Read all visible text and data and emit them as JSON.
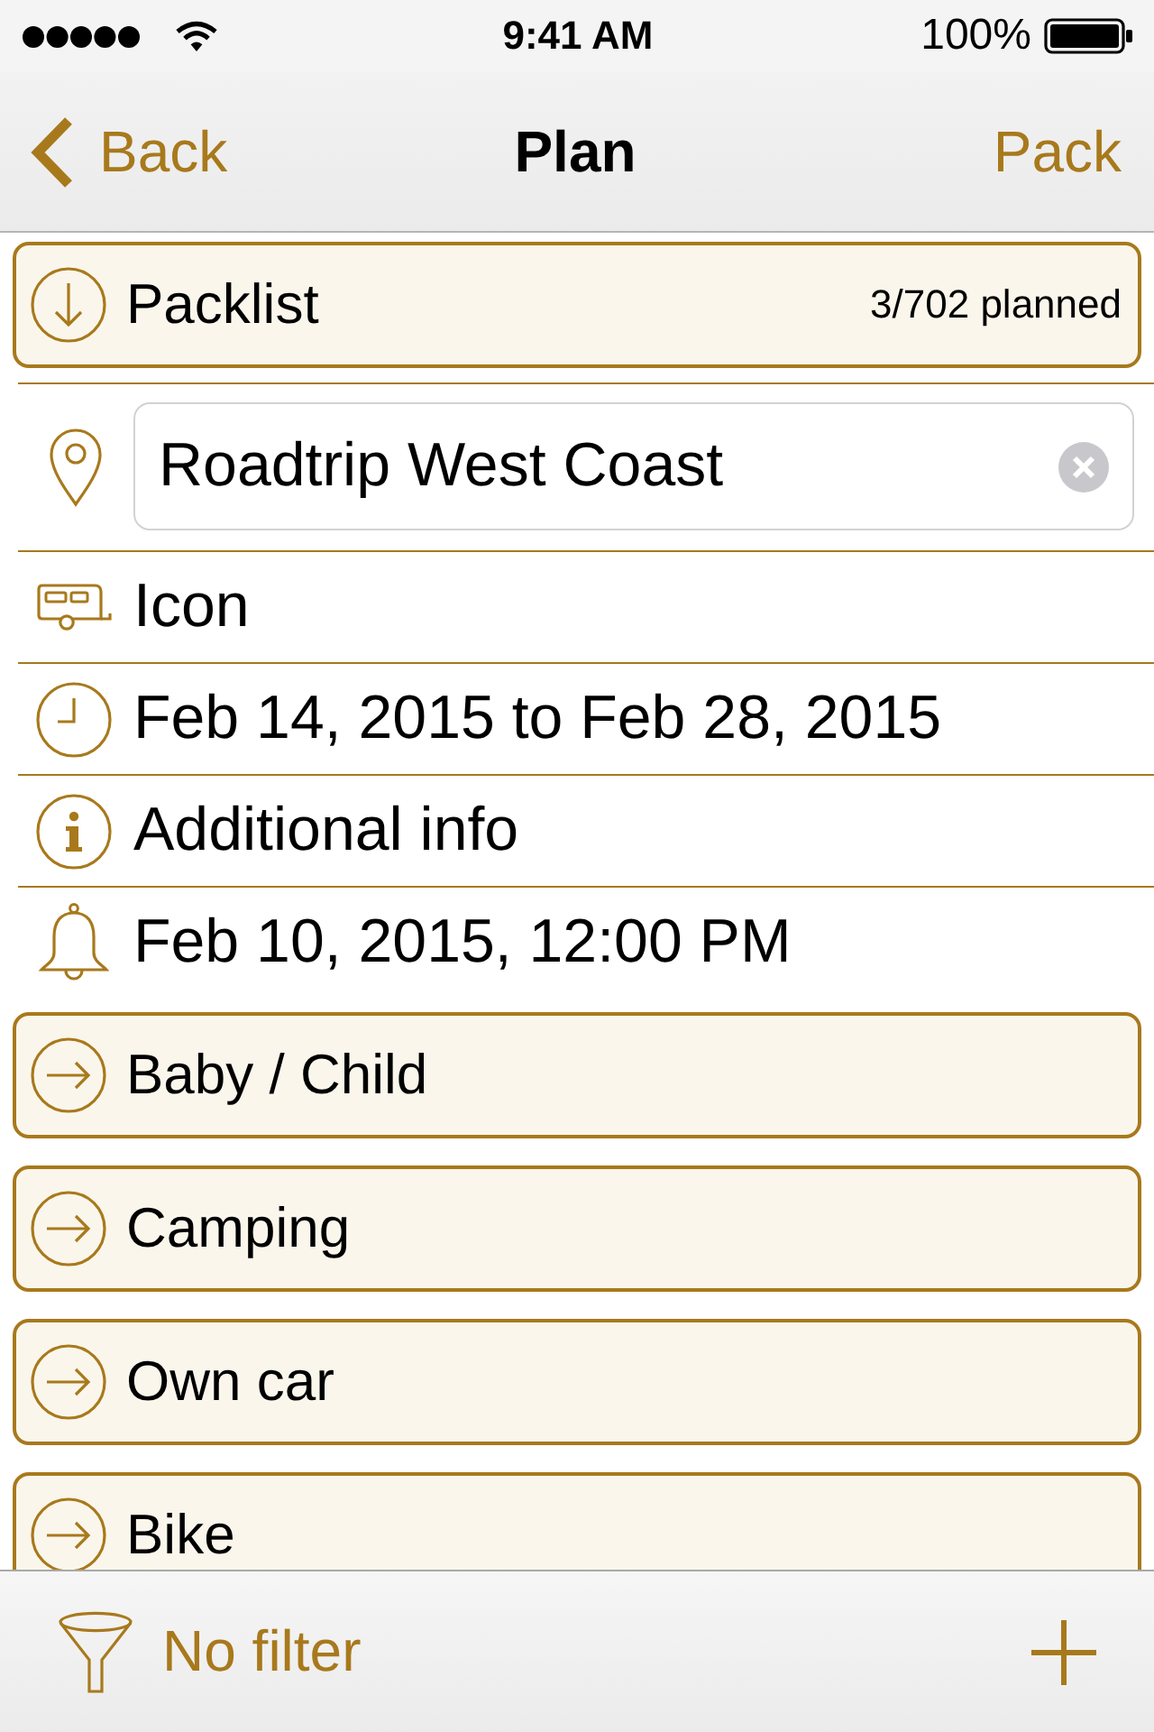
{
  "status_bar": {
    "time": "9:41 AM",
    "battery": "100%"
  },
  "nav_bar": {
    "back": "Back",
    "title": "Plan",
    "action": "Pack"
  },
  "packlist": {
    "label": "Packlist",
    "count": "3/702 planned"
  },
  "trip_name": {
    "value": "Roadtrip West Coast"
  },
  "details": [
    {
      "kind": "icon",
      "text": "Icon"
    },
    {
      "kind": "dates",
      "text": "Feb 14, 2015 to Feb 28, 2015"
    },
    {
      "kind": "info",
      "text": "Additional info"
    },
    {
      "kind": "reminder",
      "text": "Feb 10, 2015, 12:00 PM"
    }
  ],
  "categories": [
    {
      "label": "Baby / Child"
    },
    {
      "label": "Camping"
    },
    {
      "label": "Own car"
    },
    {
      "label": "Bike"
    }
  ],
  "toolbar": {
    "filter": "No filter"
  }
}
